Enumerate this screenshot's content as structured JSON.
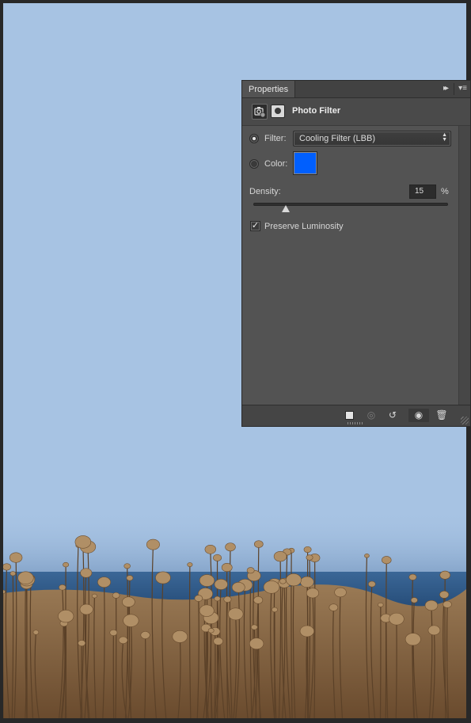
{
  "panel": {
    "tab_label": "Properties",
    "title": "Photo Filter",
    "collapse_glyph": "▸▸",
    "menu_glyph": "▾≡"
  },
  "filter": {
    "label": "Filter:",
    "selected": "Cooling Filter (LBB)",
    "mode": "filter"
  },
  "color": {
    "label": "Color:",
    "value": "#005ffe"
  },
  "density": {
    "label": "Density:",
    "value": "15",
    "unit": "%",
    "fraction": 0.15
  },
  "preserve_luminosity": {
    "label": "Preserve Luminosity",
    "checked": true
  },
  "icons": {
    "adjustment": "photo-filter-adjustment-icon",
    "mask": "layer-mask-icon",
    "clip": "clip-to-layer-icon",
    "view_previous": "view-previous-state-icon",
    "reset": "reset-icon",
    "visibility": "eye-icon",
    "delete": "trash-icon"
  },
  "colors": {
    "sky": "#a7c3e3",
    "sea": "#2c5785",
    "field": "#8a6a44",
    "panel_bg": "#535353"
  }
}
